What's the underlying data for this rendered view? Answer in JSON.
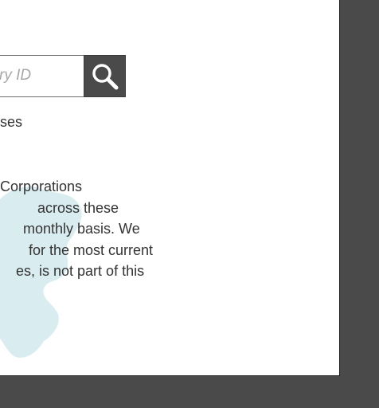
{
  "search": {
    "placeholder_fragment": "ry ID",
    "button_icon": "search-icon"
  },
  "partial_text": "ses",
  "description_lines": [
    "Corporations",
    "across these",
    "monthly basis. We",
    "for the most current",
    "es, is not part of this"
  ],
  "colors": {
    "background": "#4a4a4a",
    "panel": "#ffffff",
    "button": "#4a4a4a",
    "map": "#d9ecf0",
    "text": "#333333",
    "placeholder": "#a8a8a8"
  }
}
